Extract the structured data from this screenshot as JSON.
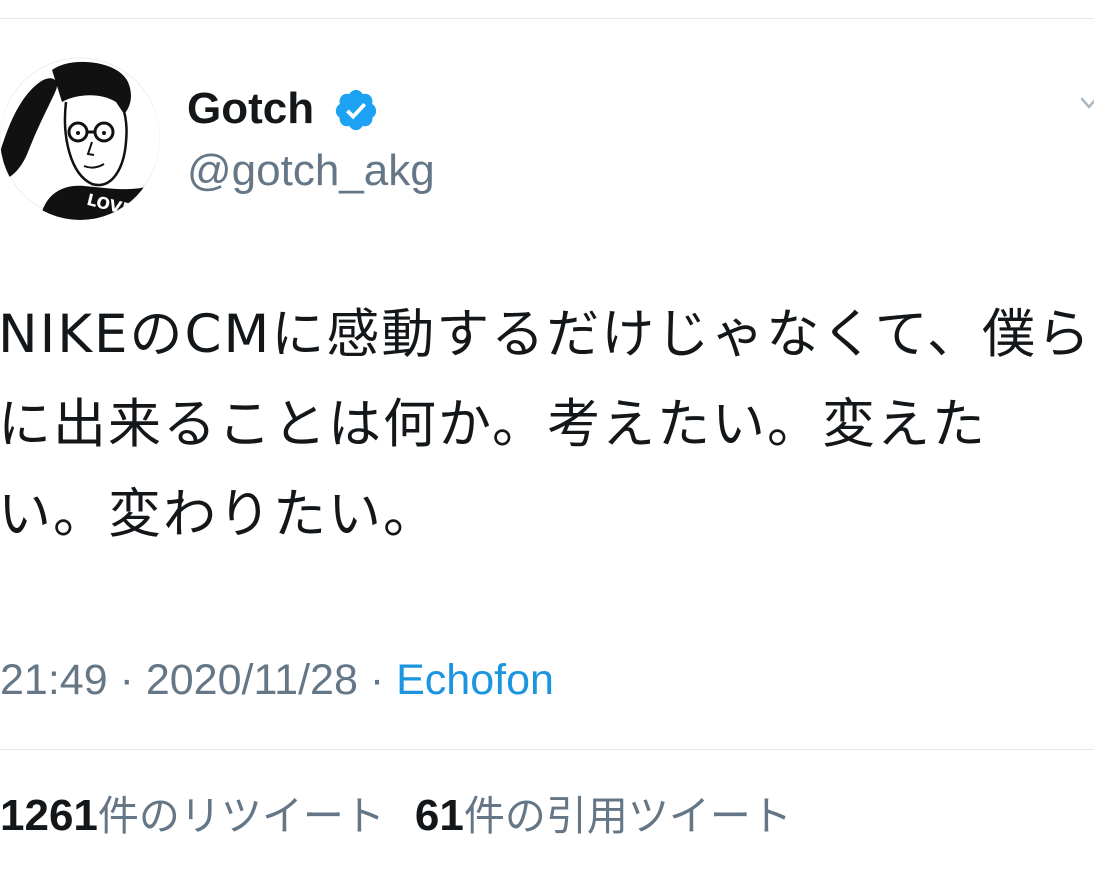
{
  "author": {
    "display_name": "Gotch",
    "handle": "@gotch_akg",
    "avatar_shirt_text": "LOVE"
  },
  "tweet": {
    "text": "NIKEのCMに感動するだけじゃなくて、僕らに出来ることは何か。考えたい。変えたい。変わりたい。"
  },
  "meta": {
    "time": "21:49",
    "separator": "·",
    "date": "2020/11/28",
    "source": "Echofon"
  },
  "stats": {
    "retweets_count": "1261",
    "retweets_label": "件のリツイート",
    "quotes_count": "61",
    "quotes_label": "件の引用ツイート"
  },
  "colors": {
    "text": "#14171a",
    "secondary": "#657786",
    "link": "#1b95e0",
    "verified": "#1da1f2",
    "divider": "#e1e8ed"
  },
  "icons": {
    "verified": "verified-badge-icon",
    "caret": "chevron-down-icon"
  }
}
